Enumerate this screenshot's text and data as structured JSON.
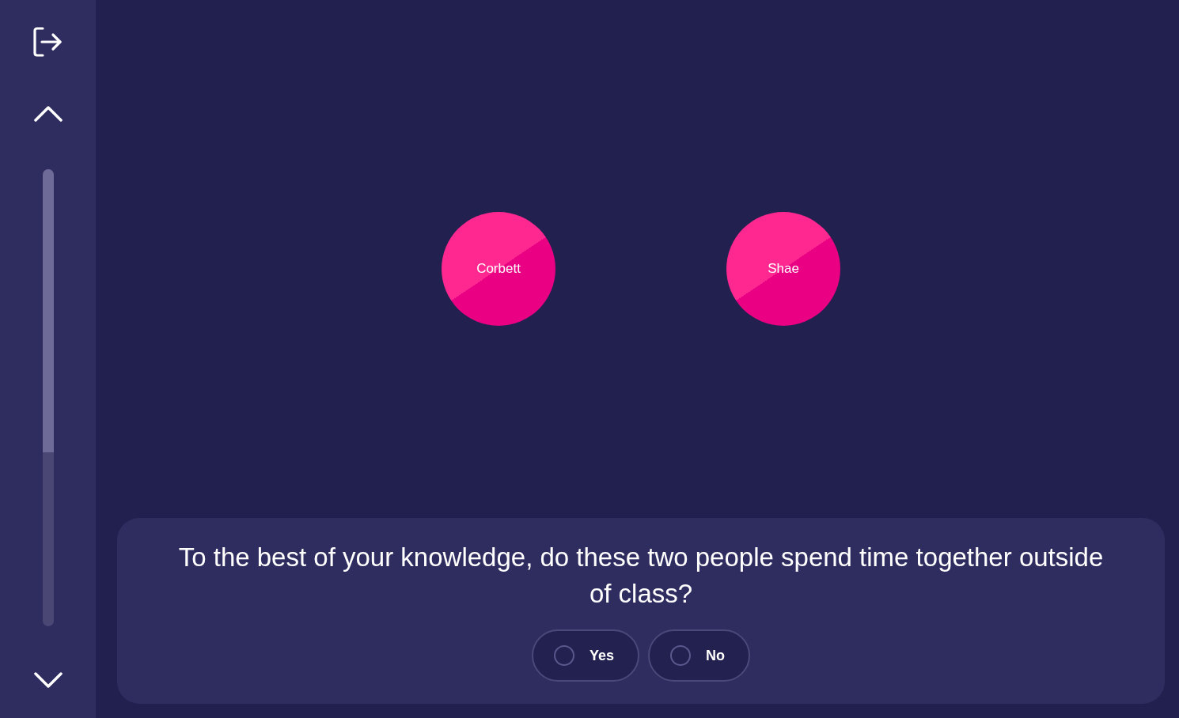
{
  "sidebar": {
    "progress": {
      "level": 0.62
    }
  },
  "people": [
    {
      "name": "Corbett"
    },
    {
      "name": "Shae"
    }
  ],
  "question": {
    "text": "To the best of your knowledge, do these two people spend time together outside of class?",
    "options": [
      {
        "label": "Yes",
        "selected": false
      },
      {
        "label": "No",
        "selected": false
      }
    ]
  }
}
